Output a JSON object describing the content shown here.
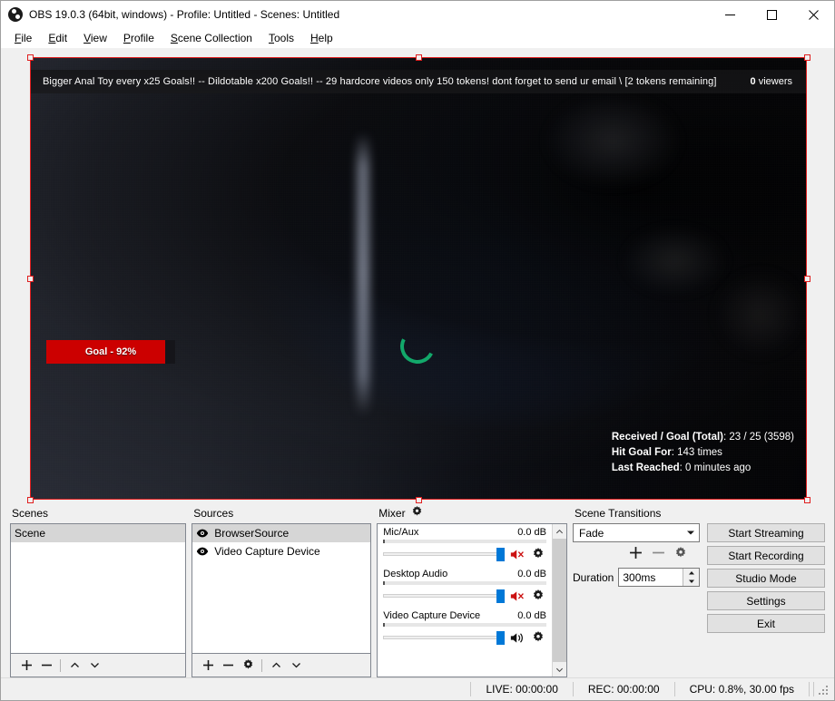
{
  "window": {
    "title": "OBS 19.0.3 (64bit, windows) - Profile: Untitled - Scenes: Untitled",
    "icon": "obs-logo-icon",
    "minimize": "minimize-icon",
    "maximize": "maximize-icon",
    "close": "close-icon"
  },
  "menu": {
    "items": [
      {
        "label": "File",
        "mnemonic": "F",
        "rest": "ile"
      },
      {
        "label": "Edit",
        "mnemonic": "E",
        "rest": "dit"
      },
      {
        "label": "View",
        "mnemonic": "V",
        "rest": "iew"
      },
      {
        "label": "Profile",
        "mnemonic": "P",
        "rest": "rofile"
      },
      {
        "label": "Scene Collection",
        "mnemonic": "S",
        "rest": "cene Collection"
      },
      {
        "label": "Tools",
        "mnemonic": "T",
        "rest": "ools"
      },
      {
        "label": "Help",
        "mnemonic": "H",
        "rest": "elp"
      }
    ]
  },
  "preview": {
    "ticker_text": "Bigger Anal Toy every x25 Goals!! -- Dildotable x200 Goals!! -- 29 hardcore videos only 150 tokens! dont forget to send ur email \\ [2 tokens remaining]",
    "viewers_count": "0",
    "viewers_label": "viewers",
    "goal_label": "Goal - 92%",
    "goal_percent": 92,
    "stats": {
      "received_goal_label": "Received / Goal (Total)",
      "received_goal_value": "23 / 25 (3598)",
      "hit_goal_label": "Hit Goal For",
      "hit_goal_value": "143 times",
      "last_reached_label": "Last Reached",
      "last_reached_value": "0 minutes ago"
    },
    "selection_color": "#e01f1f",
    "spinner_color": "#12a86a"
  },
  "scenes": {
    "title": "Scenes",
    "items": [
      {
        "label": "Scene",
        "selected": true
      }
    ],
    "toolbar": {
      "add": "+",
      "remove": "−",
      "move_up": "up-chevron-icon",
      "move_down": "down-chevron-icon"
    }
  },
  "sources": {
    "title": "Sources",
    "items": [
      {
        "label": "BrowserSource",
        "visible": true,
        "selected": true
      },
      {
        "label": "Video Capture Device",
        "visible": true,
        "selected": false
      }
    ],
    "toolbar": {
      "add": "+",
      "remove": "−",
      "properties": "gear-icon",
      "move_up": "up-chevron-icon",
      "move_down": "down-chevron-icon"
    }
  },
  "mixer": {
    "title": "Mixer",
    "settings_icon": "gear-icon",
    "channels": [
      {
        "name": "Mic/Aux",
        "db": "0.0 dB",
        "muted": true,
        "volume_percent": 100
      },
      {
        "name": "Desktop Audio",
        "db": "0.0 dB",
        "muted": true,
        "volume_percent": 100
      },
      {
        "name": "Video Capture Device",
        "db": "0.0 dB",
        "muted": false,
        "volume_percent": 100
      }
    ],
    "scroll_up": "up-chevron-icon",
    "scroll_down": "down-chevron-icon"
  },
  "transitions": {
    "title": "Scene Transitions",
    "selected": "Fade",
    "options": [
      "Fade"
    ],
    "add": "+",
    "remove": "−",
    "properties": "gear-icon",
    "duration_label": "Duration",
    "duration_value": "300ms"
  },
  "controls": {
    "buttons": [
      {
        "label": "Start Streaming"
      },
      {
        "label": "Start Recording"
      },
      {
        "label": "Studio Mode"
      },
      {
        "label": "Settings"
      },
      {
        "label": "Exit"
      }
    ]
  },
  "statusbar": {
    "live": "LIVE: 00:00:00",
    "rec": "REC: 00:00:00",
    "cpu": "CPU: 0.8%, 30.00 fps"
  }
}
